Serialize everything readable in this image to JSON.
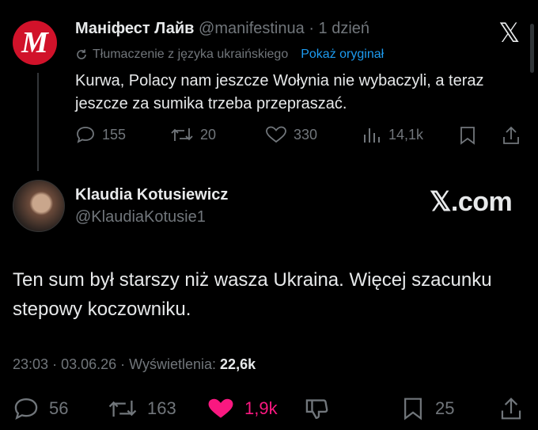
{
  "original_tweet": {
    "avatar_letter": "M",
    "avatar_color": "#d1122a",
    "display_name": "Маніфест Лайв",
    "handle": "@manifestinua",
    "separator": "·",
    "time_ago": "1 dzień",
    "translation_note": "Tłumaczenie z języka ukraińskiego",
    "show_original": "Pokaż oryginał",
    "text": "Kurwa, Polacy nam jeszcze Wołynia nie wybaczyli, a teraz jeszcze za sumika trzeba przepraszać.",
    "replies": "155",
    "reposts": "20",
    "likes": "330",
    "views": "14,1k"
  },
  "close_icon_glyph": "𝕏",
  "reply_tweet": {
    "display_name": "Klaudia Kotusiewicz",
    "handle": "@KlaudiaKotusie1",
    "text": "Ten sum był starszy niż wasza Ukraina. Więcej szacunku stepowy koczowniku.",
    "time": "23:03",
    "date": "03.06.26",
    "views_label": "Wyświetlenia:",
    "views": "22,6k",
    "replies": "56",
    "reposts": "163",
    "likes": "1,9k",
    "like_color": "#f91880",
    "bookmarks": "25"
  },
  "watermark": "𝕏.com"
}
